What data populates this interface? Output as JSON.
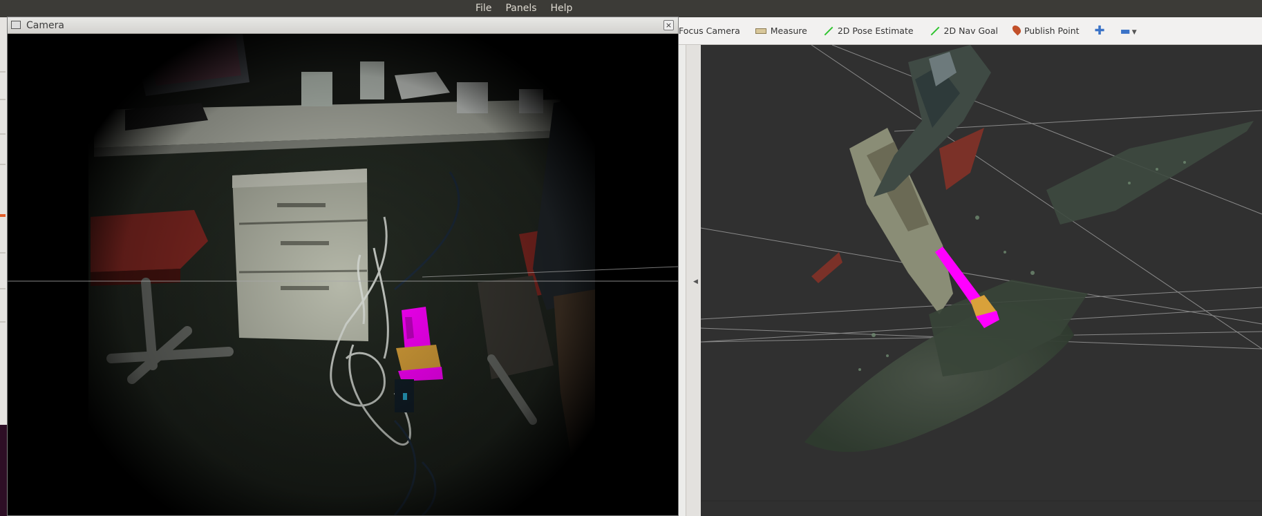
{
  "menubar": {
    "menus": [
      "File",
      "Panels",
      "Help"
    ]
  },
  "toolbar": {
    "tools": [
      {
        "label": "Focus Camera",
        "icon": "focus-camera-icon"
      },
      {
        "label": "Measure",
        "icon": "ruler-icon"
      },
      {
        "label": "2D Pose Estimate",
        "icon": "green-arrow-icon"
      },
      {
        "label": "2D Nav Goal",
        "icon": "green-arrow-icon"
      },
      {
        "label": "Publish Point",
        "icon": "map-pin-icon"
      }
    ],
    "add_icon": "plus-icon",
    "remove_icon": "minus-icon"
  },
  "camera_window": {
    "title": "Camera",
    "close_symbol": "×"
  },
  "colors": {
    "highlight_magenta": "#ff00ff",
    "object_orange": "#d9a13a",
    "grid": "#a8a8a8",
    "view_background": "#303030"
  }
}
